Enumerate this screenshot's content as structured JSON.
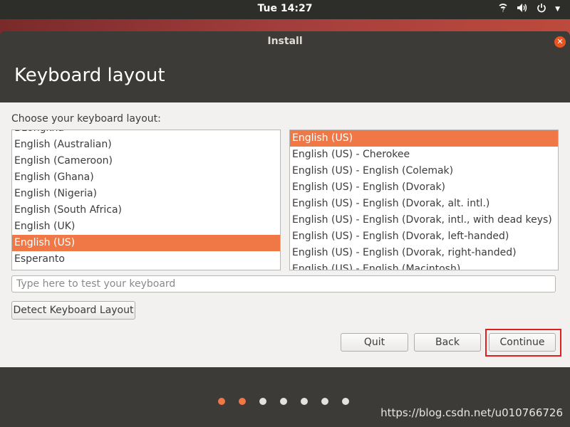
{
  "topbar": {
    "clock": "Tue 14:27",
    "icons": [
      "network-icon",
      "volume-icon",
      "power-icon",
      "chevron-down-icon"
    ]
  },
  "window": {
    "title": "Install",
    "heading": "Keyboard layout"
  },
  "content": {
    "prompt": "Choose your keyboard layout:",
    "layouts": [
      "Dzongkha",
      "English (Australian)",
      "English (Cameroon)",
      "English (Ghana)",
      "English (Nigeria)",
      "English (South Africa)",
      "English (UK)",
      "English (US)",
      "Esperanto"
    ],
    "selected_layout": "English (US)",
    "variants": [
      "English (US)",
      "English (US) - Cherokee",
      "English (US) - English (Colemak)",
      "English (US) - English (Dvorak)",
      "English (US) - English (Dvorak, alt. intl.)",
      "English (US) - English (Dvorak, intl., with dead keys)",
      "English (US) - English (Dvorak, left-handed)",
      "English (US) - English (Dvorak, right-handed)",
      "English (US) - English (Macintosh)"
    ],
    "selected_variant": "English (US)",
    "test_placeholder": "Type here to test your keyboard",
    "detect_label": "Detect Keyboard Layout"
  },
  "buttons": {
    "quit": "Quit",
    "back": "Back",
    "continue": "Continue"
  },
  "progress": {
    "total_steps": 7,
    "completed_steps": 2
  },
  "watermark": "https://blog.csdn.net/u010766726",
  "colors": {
    "accent": "#f07746",
    "titlebar": "#3c3b37",
    "highlight": "#e02020"
  }
}
